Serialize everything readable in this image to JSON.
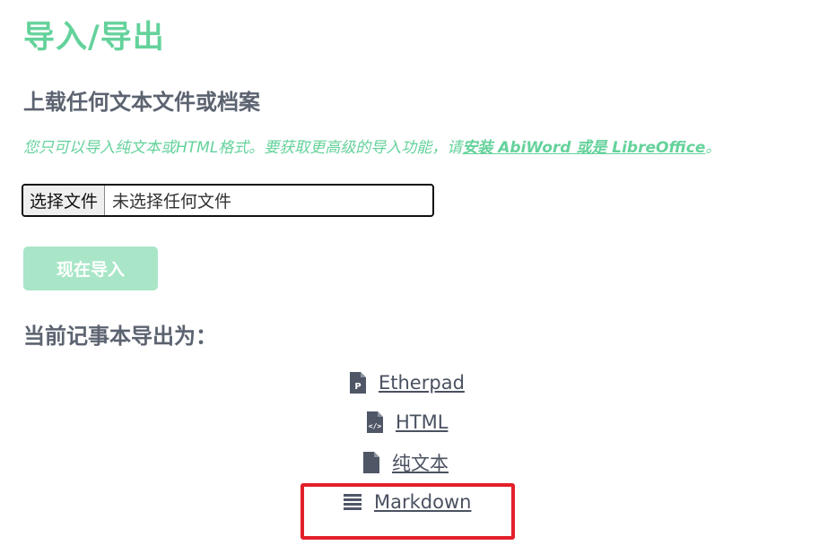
{
  "page": {
    "title": "导入/导出",
    "import_heading": "上载任何文本文件或档案",
    "hint_prefix": "您只可以导入纯文本或HTML格式。要获取更高级的导入功能，请",
    "hint_link": "安装 AbiWord 或是 LibreOffice",
    "hint_suffix": "。",
    "file_button_label": "选择文件",
    "file_status": "未选择任何文件",
    "import_button_label": "现在导入",
    "export_heading": "当前记事本导出为："
  },
  "export_options": [
    {
      "label": "Etherpad",
      "icon": "file-etherpad-icon"
    },
    {
      "label": "HTML",
      "icon": "file-code-icon"
    },
    {
      "label": "纯文本",
      "icon": "file-icon"
    },
    {
      "label": "Markdown",
      "icon": "list-lines-icon"
    }
  ],
  "colors": {
    "accent_green": "#64d29b",
    "button_disabled_green": "#a8e6c7",
    "heading_gray": "#5c6370",
    "link_gray": "#4a5160",
    "highlight_red": "#e3202a"
  }
}
